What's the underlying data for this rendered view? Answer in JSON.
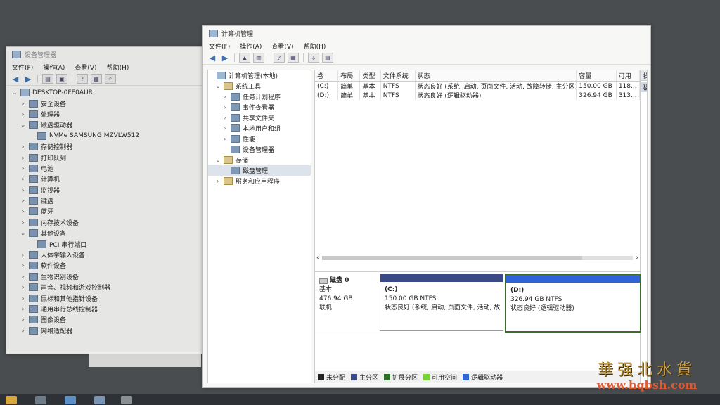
{
  "device_manager": {
    "title": "设备管理器",
    "menu": [
      "文件(F)",
      "操作(A)",
      "查看(V)",
      "帮助(H)"
    ],
    "tree": [
      {
        "label": "DESKTOP-0FE0AUR",
        "level": 0,
        "tw": "⌄"
      },
      {
        "label": "安全设备",
        "level": 1,
        "tw": "›"
      },
      {
        "label": "处理器",
        "level": 1,
        "tw": "›"
      },
      {
        "label": "磁盘驱动器",
        "level": 1,
        "tw": "⌄"
      },
      {
        "label": "NVMe SAMSUNG MZVLW512",
        "level": 2,
        "tw": ""
      },
      {
        "label": "存储控制器",
        "level": 1,
        "tw": "›"
      },
      {
        "label": "打印队列",
        "level": 1,
        "tw": "›"
      },
      {
        "label": "电池",
        "level": 1,
        "tw": "›"
      },
      {
        "label": "计算机",
        "level": 1,
        "tw": "›"
      },
      {
        "label": "监视器",
        "level": 1,
        "tw": "›"
      },
      {
        "label": "键盘",
        "level": 1,
        "tw": "›"
      },
      {
        "label": "蓝牙",
        "level": 1,
        "tw": "›"
      },
      {
        "label": "内存技术设备",
        "level": 1,
        "tw": "›"
      },
      {
        "label": "其他设备",
        "level": 1,
        "tw": "⌄"
      },
      {
        "label": "PCI 串行端口",
        "level": 2,
        "tw": ""
      },
      {
        "label": "人体学输入设备",
        "level": 1,
        "tw": "›"
      },
      {
        "label": "软件设备",
        "level": 1,
        "tw": "›"
      },
      {
        "label": "生物识别设备",
        "level": 1,
        "tw": "›"
      },
      {
        "label": "声音、视频和游戏控制器",
        "level": 1,
        "tw": "›"
      },
      {
        "label": "鼠标和其他指针设备",
        "level": 1,
        "tw": "›"
      },
      {
        "label": "通用串行总线控制器",
        "level": 1,
        "tw": "›"
      },
      {
        "label": "图像设备",
        "level": 1,
        "tw": "›"
      },
      {
        "label": "网络适配器",
        "level": 1,
        "tw": "›"
      }
    ]
  },
  "computer_management": {
    "title": "计算机管理",
    "menu": [
      "文件(F)",
      "操作(A)",
      "查看(V)",
      "帮助(H)"
    ],
    "nav": [
      {
        "label": "计算机管理(本地)",
        "level": 0,
        "tw": ""
      },
      {
        "label": "系统工具",
        "level": 1,
        "tw": "⌄"
      },
      {
        "label": "任务计划程序",
        "level": 2,
        "tw": "›"
      },
      {
        "label": "事件查看器",
        "level": 2,
        "tw": "›"
      },
      {
        "label": "共享文件夹",
        "level": 2,
        "tw": "›"
      },
      {
        "label": "本地用户和组",
        "level": 2,
        "tw": "›"
      },
      {
        "label": "性能",
        "level": 2,
        "tw": "›"
      },
      {
        "label": "设备管理器",
        "level": 2,
        "tw": ""
      },
      {
        "label": "存储",
        "level": 1,
        "tw": "⌄"
      },
      {
        "label": "磁盘管理",
        "level": 2,
        "tw": "",
        "selected": true
      },
      {
        "label": "服务和应用程序",
        "level": 1,
        "tw": "›"
      }
    ],
    "columns": [
      "卷",
      "布局",
      "类型",
      "文件系统",
      "状态",
      "容量",
      "可用"
    ],
    "volumes": [
      [
        "(C:)",
        "简单",
        "基本",
        "NTFS",
        "状态良好 (系统, 启动, 页面文件, 活动, 故障转储, 主分区)",
        "150.00 GB",
        "118..."
      ],
      [
        "(D:)",
        "简单",
        "基本",
        "NTFS",
        "状态良好 (逻辑驱动器)",
        "326.94 GB",
        "313..."
      ]
    ],
    "disk": {
      "name": "磁盘 0",
      "type": "基本",
      "size": "476.94 GB",
      "state": "联机"
    },
    "partitions": [
      {
        "letter": "(C:)",
        "size": "150.00 GB NTFS",
        "status": "状态良好 (系统, 启动, 页面文件, 活动, 故",
        "color": "#3b4a86"
      },
      {
        "letter": "(D:)",
        "size": "326.94 GB NTFS",
        "status": "状态良好 (逻辑驱动器)",
        "color": "#2f63d6"
      }
    ],
    "legend": [
      {
        "label": "未分配",
        "color": "#222222"
      },
      {
        "label": "主分区",
        "color": "#3b4a86"
      },
      {
        "label": "扩展分区",
        "color": "#2f6e2a"
      },
      {
        "label": "可用空间",
        "color": "#7ad03a"
      },
      {
        "label": "逻辑驱动器",
        "color": "#2f63d6"
      }
    ],
    "actions": {
      "header": "操作",
      "item": "磁盘"
    }
  },
  "watermark": {
    "cn": "華强北水貨",
    "url": "www.hqbsh.com"
  }
}
